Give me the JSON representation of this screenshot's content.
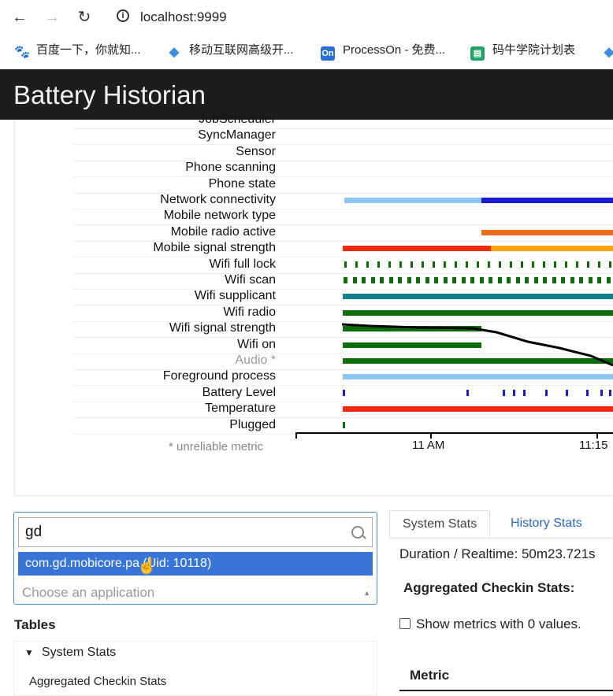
{
  "browser": {
    "url": "localhost:9999",
    "bookmarks": [
      {
        "label": "百度一下，你就知...",
        "icon": "baidu-icon",
        "color": "#2932e1"
      },
      {
        "label": "移动互联网高级开...",
        "icon": "diamond-icon",
        "color": "#3a8de0"
      },
      {
        "label": "ProcessOn - 免费...",
        "icon": "processon-icon",
        "icon_text": "On",
        "color": "#2b6fd6"
      },
      {
        "label": "码牛学院计划表",
        "icon": "sheet-icon",
        "color": "#1fa463"
      }
    ]
  },
  "header": {
    "title": "Battery Historian"
  },
  "timeline": {
    "rows": [
      "JobScheduler",
      "SyncManager",
      "Sensor",
      "Phone scanning",
      "Phone state",
      "Network connectivity",
      "Mobile network type",
      "Mobile radio active",
      "Mobile signal strength",
      "Wifi full lock",
      "Wifi scan",
      "Wifi supplicant",
      "Wifi radio",
      "Wifi signal strength",
      "Wifi on",
      "Audio *",
      "Foreground process",
      "Battery Level",
      "Temperature",
      "Plugged"
    ],
    "axis_ticks": [
      "11 AM",
      "11:15"
    ],
    "footnote": "* unreliable metric",
    "colors": {
      "light_blue": "#90c4f0",
      "dark_blue": "#1a1ad0",
      "orange": "#f26b1d",
      "red": "#f02a10",
      "amber": "#ffa500",
      "green": "#0b6e0b",
      "teal": "#12818c",
      "battery_line": "#000000"
    }
  },
  "app_selector": {
    "query": "gd",
    "highlighted_option": "com.gd.mobicore.pa (Uid: 10118)",
    "placeholder": "Choose an application"
  },
  "tables": {
    "title": "Tables",
    "section": "System Stats",
    "items": [
      "Aggregated Checkin Stats"
    ]
  },
  "stats": {
    "tabs": [
      "System Stats",
      "History Stats"
    ],
    "duration": "Duration / Realtime: 50m23.721s",
    "aggregated_title": "Aggregated Checkin Stats:",
    "show_metrics": "Show metrics with 0 values.",
    "metric_header": "Metric"
  }
}
